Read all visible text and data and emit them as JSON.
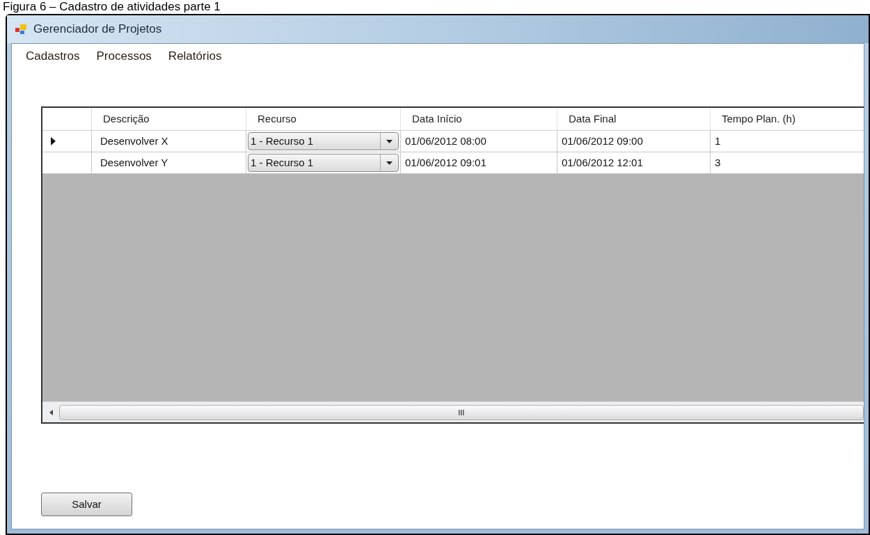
{
  "caption": "Figura 6 – Cadastro de atividades parte 1",
  "window": {
    "title": "Gerenciador de Projetos"
  },
  "menu": [
    "Cadastros",
    "Processos",
    "Relatórios"
  ],
  "table": {
    "columns": [
      "Descrição",
      "Recurso",
      "Data Início",
      "Data Final",
      "Tempo Plan. (h)"
    ],
    "rows": [
      {
        "selected": true,
        "cells": [
          "Desenvolver X",
          "1 - Recurso 1",
          "01/06/2012 08:00",
          "01/06/2012 09:00",
          "1"
        ]
      },
      {
        "selected": false,
        "cells": [
          "Desenvolver Y",
          "1 - Recurso 1",
          "01/06/2012 09:01",
          "01/06/2012 12:01",
          "3"
        ]
      }
    ]
  },
  "buttons": [
    "Salvar"
  ]
}
